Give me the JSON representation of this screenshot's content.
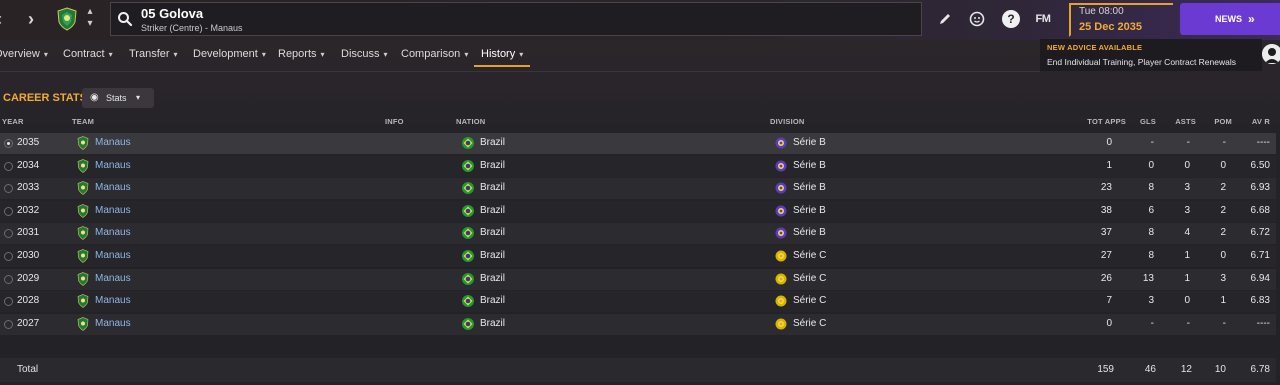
{
  "header": {
    "player_name": "05 Golova",
    "player_subtitle": "Striker (Centre) - Manaus",
    "fm_label": "FM",
    "help_label": "?",
    "date_time": "Tue 08:00",
    "date_day": "25 Dec 2035",
    "news_label": "NEWS"
  },
  "tabs": [
    {
      "label": "Overview"
    },
    {
      "label": "Contract"
    },
    {
      "label": "Transfer"
    },
    {
      "label": "Development"
    },
    {
      "label": "Reports"
    },
    {
      "label": "Discuss"
    },
    {
      "label": "Comparison"
    },
    {
      "label": "History"
    }
  ],
  "advice": {
    "title": "NEW ADVICE AVAILABLE",
    "text": "End Individual Training, Player Contract Renewals"
  },
  "section": {
    "title": "CAREER STATS",
    "view_label": "Stats"
  },
  "columns": {
    "year": "YEAR",
    "team": "TEAM",
    "info": "INFO",
    "nation": "NATION",
    "division": "DIVISION",
    "tot_apps": "TOT APPS",
    "gls": "GLS",
    "asts": "ASTS",
    "pom": "POM",
    "av_r": "AV R"
  },
  "rows": [
    {
      "year": "2035",
      "team": "Manaus",
      "nation": "Brazil",
      "division": "Série B",
      "tier": "b",
      "apps": "0",
      "gls": "-",
      "asts": "-",
      "pom": "-",
      "avr": "----"
    },
    {
      "year": "2034",
      "team": "Manaus",
      "nation": "Brazil",
      "division": "Série B",
      "tier": "b",
      "apps": "1",
      "gls": "0",
      "asts": "0",
      "pom": "0",
      "avr": "6.50"
    },
    {
      "year": "2033",
      "team": "Manaus",
      "nation": "Brazil",
      "division": "Série B",
      "tier": "b",
      "apps": "23",
      "gls": "8",
      "asts": "3",
      "pom": "2",
      "avr": "6.93"
    },
    {
      "year": "2032",
      "team": "Manaus",
      "nation": "Brazil",
      "division": "Série B",
      "tier": "b",
      "apps": "38",
      "gls": "6",
      "asts": "3",
      "pom": "2",
      "avr": "6.68"
    },
    {
      "year": "2031",
      "team": "Manaus",
      "nation": "Brazil",
      "division": "Série B",
      "tier": "b",
      "apps": "37",
      "gls": "8",
      "asts": "4",
      "pom": "2",
      "avr": "6.72"
    },
    {
      "year": "2030",
      "team": "Manaus",
      "nation": "Brazil",
      "division": "Série C",
      "tier": "c",
      "apps": "27",
      "gls": "8",
      "asts": "1",
      "pom": "0",
      "avr": "6.71"
    },
    {
      "year": "2029",
      "team": "Manaus",
      "nation": "Brazil",
      "division": "Série C",
      "tier": "c",
      "apps": "26",
      "gls": "13",
      "asts": "1",
      "pom": "3",
      "avr": "6.94"
    },
    {
      "year": "2028",
      "team": "Manaus",
      "nation": "Brazil",
      "division": "Série C",
      "tier": "c",
      "apps": "7",
      "gls": "3",
      "asts": "0",
      "pom": "1",
      "avr": "6.83"
    },
    {
      "year": "2027",
      "team": "Manaus",
      "nation": "Brazil",
      "division": "Série C",
      "tier": "c",
      "apps": "0",
      "gls": "-",
      "asts": "-",
      "pom": "-",
      "avr": "----"
    }
  ],
  "total": {
    "label": "Total",
    "apps": "159",
    "gls": "46",
    "asts": "12",
    "pom": "10",
    "avr": "6.78"
  },
  "colors": {
    "accent": "#e8a02c",
    "news": "#6a3ad3",
    "team_link": "#8fb6e8",
    "serie_b": "#5b3bc4",
    "serie_c": "#d7b400"
  },
  "icons": [
    "back-arrow-icon",
    "forward-arrow-icon",
    "search-icon",
    "edit-icon",
    "face-icon",
    "help-icon",
    "chevron-double-right-icon",
    "eye-icon",
    "club-badge-icon",
    "brazil-flag-icon",
    "competition-icon"
  ]
}
